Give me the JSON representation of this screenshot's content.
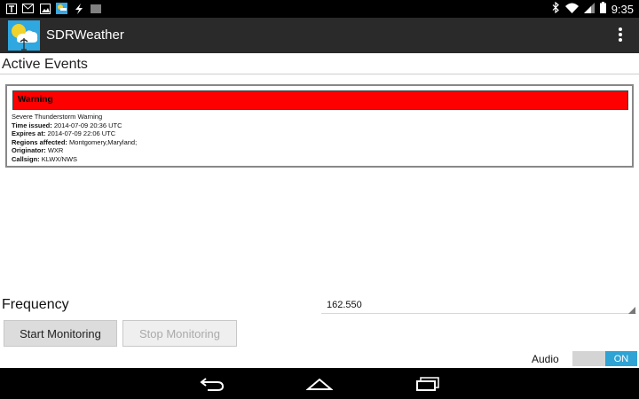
{
  "status_bar": {
    "time": "9:35",
    "left_icons": [
      "t-icon",
      "mail-icon",
      "image-icon",
      "app-icon",
      "lightning-icon",
      "barcode-icon"
    ],
    "right_icons": [
      "bluetooth-icon",
      "wifi-icon",
      "signal-icon",
      "battery-icon"
    ]
  },
  "action_bar": {
    "title": "SDRWeather",
    "overflow_icon": "overflow-menu-icon"
  },
  "active_events": {
    "title": "Active Events",
    "events": [
      {
        "header": "Warning",
        "header_color": "#ff0000",
        "event_name": "Severe Thunderstorm Warning",
        "time_issued_label": "Time issued:",
        "time_issued": "2014-07-09 20:36 UTC",
        "expires_label": "Expires at:",
        "expires": "2014-07-09 22:06 UTC",
        "regions_label": "Regions affected:",
        "regions": "Montgomery,Maryland;",
        "originator_label": "Originator:",
        "originator": "WXR",
        "callsign_label": "Callsign:",
        "callsign": "KLWX/NWS"
      }
    ]
  },
  "frequency": {
    "label": "Frequency",
    "value": "162.550"
  },
  "buttons": {
    "start": "Start Monitoring",
    "stop": "Stop Monitoring"
  },
  "audio": {
    "label": "Audio",
    "toggle_state": "ON",
    "toggle_color": "#2ea3d4"
  },
  "nav_bar": {
    "icons": [
      "back-icon",
      "home-icon",
      "recents-icon"
    ]
  }
}
